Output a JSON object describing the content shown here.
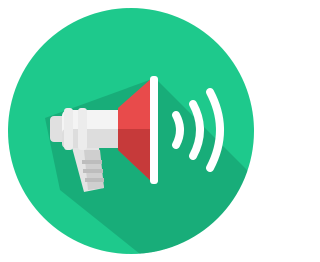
{
  "icon": {
    "name": "megaphone-icon",
    "description_visible_text": "",
    "colors": {
      "background": "#ffffff",
      "circle": "#1ec98c",
      "long_shadow": "#17a876",
      "horn_outer": "#e84b4b",
      "horn_inner": "#c63a3a",
      "body_white": "#f2f2f2",
      "body_shade": "#d8d8d8",
      "sound_waves": "#ffffff"
    }
  }
}
